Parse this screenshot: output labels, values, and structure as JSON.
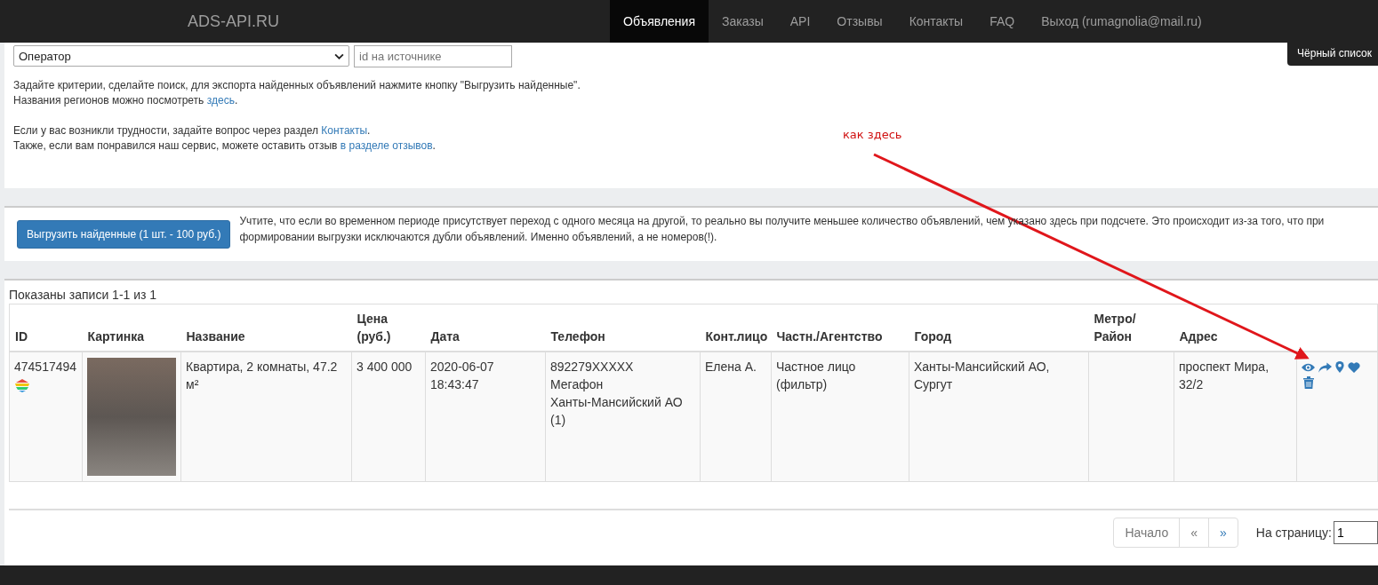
{
  "navbar": {
    "brand": "ADS-API.RU",
    "items": [
      {
        "label": "Объявления",
        "selected": true
      },
      {
        "label": "Заказы",
        "selected": false
      },
      {
        "label": "API",
        "selected": false
      },
      {
        "label": "Отзывы",
        "selected": false
      },
      {
        "label": "Контакты",
        "selected": false
      },
      {
        "label": "FAQ",
        "selected": false
      },
      {
        "label": "Выход (rumagnolia@mail.ru)",
        "selected": false
      }
    ]
  },
  "blacklist_button": "Чёрный список",
  "filters": {
    "operator_select": "Оператор",
    "source_id": {
      "placeholder": "id на источнике"
    }
  },
  "info": [
    [
      {
        "text": "Задайте критерии, сделайте поиск, для экспорта найденных объявлений нажмите кнопку \"Выгрузить найденные\"."
      }
    ],
    [
      {
        "text": "Названия регионов можно посмотреть "
      },
      {
        "text": "здесь",
        "link": true
      },
      {
        "text": "."
      }
    ],
    [
      {
        "text": "Если у вас возникли трудности, задайте вопрос через раздел "
      },
      {
        "text": "Контакты",
        "link": true
      },
      {
        "text": "."
      }
    ],
    [
      {
        "text": "Также, если вам понравился наш сервис, можете оставить отзыв "
      },
      {
        "text": "в разделе отзывов",
        "link": true
      },
      {
        "text": "."
      }
    ]
  ],
  "annotation": {
    "text": "как здесь"
  },
  "export": {
    "button": "Выгрузить найденные (1 шт. - 100 руб.)",
    "note": "Учтите, что если во временном периоде присутствует переход с одного месяца на другой, то реально вы получите меньшее количество объявлений, чем указано здесь при подсчете. Это происходит из-за того, что при формировании выгрузки исключаются дубли объявлений. Именно объявлений, а не номеров(!)."
  },
  "summary": "Показаны записи 1-1 из 1",
  "table": {
    "columns": [
      "ID",
      "Картинка",
      "Название",
      "Цена (руб.)",
      "Дата",
      "Телефон",
      "Конт.лицо",
      "Частн./Агентство",
      "Город",
      "Метро/ Район",
      "Адрес"
    ],
    "rows": [
      {
        "id": "474517494",
        "title": "Квартира, 2 комнаты, 47.2 м²",
        "price": "3 400 000",
        "date": [
          "2020-06-07",
          "18:43:47"
        ],
        "phone": [
          "892279XXXXX",
          "Мегафон",
          "Ханты-Мансийский АО",
          "(1)"
        ],
        "contact": "Елена А.",
        "owner_type": [
          "Частное лицо",
          "(фильтр)"
        ],
        "city": [
          "Ханты-Мансийский АО,",
          "Сургут"
        ],
        "address": [
          "проспект Мира,",
          "32/2"
        ]
      }
    ]
  },
  "pagination": {
    "items": [
      {
        "label": "Начало",
        "disabled": true
      },
      {
        "label": "«",
        "disabled": true
      },
      {
        "label": "»",
        "disabled": false
      }
    ],
    "page_label": "На страницу:",
    "page_value": "1"
  }
}
